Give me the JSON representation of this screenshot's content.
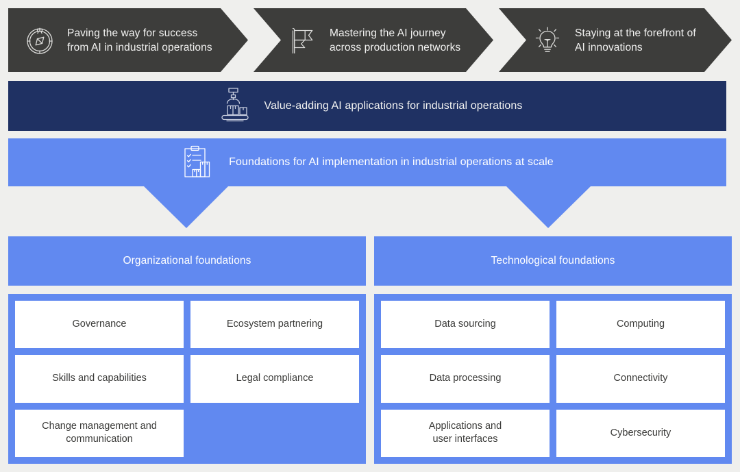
{
  "colors": {
    "background": "#efefed",
    "dark": "#3d3d3b",
    "navy": "#1f3163",
    "blue": "#6189f0",
    "white": "#ffffff",
    "text_light": "#f2f2f1",
    "text_dark": "#3a3a38"
  },
  "journey": {
    "steps": [
      {
        "icon": "compass-icon",
        "label": "Paving the way for success\nfrom AI in industrial operations"
      },
      {
        "icon": "flag-icon",
        "label": "Mastering the AI journey\nacross production networks"
      },
      {
        "icon": "lightbulb-icon",
        "label": "Staying at the forefront of\nAI innovations"
      }
    ]
  },
  "value_band": {
    "icon": "robot-arm-conveyor-icon",
    "label": "Value-adding AI applications for industrial operations"
  },
  "foundations_band": {
    "icon": "clipboard-checklist-icon",
    "label": "Foundations for AI implementation in industrial operations at scale"
  },
  "columns": [
    {
      "header": "Organizational foundations",
      "cards": [
        "Governance",
        "Ecosystem partnering",
        "Skills and capabilities",
        "Legal compliance",
        "Change management and\ncommunication",
        ""
      ]
    },
    {
      "header": "Technological foundations",
      "cards": [
        "Data sourcing",
        "Computing",
        "Data processing",
        "Connectivity",
        "Applications and\nuser interfaces",
        "Cybersecurity"
      ]
    }
  ]
}
